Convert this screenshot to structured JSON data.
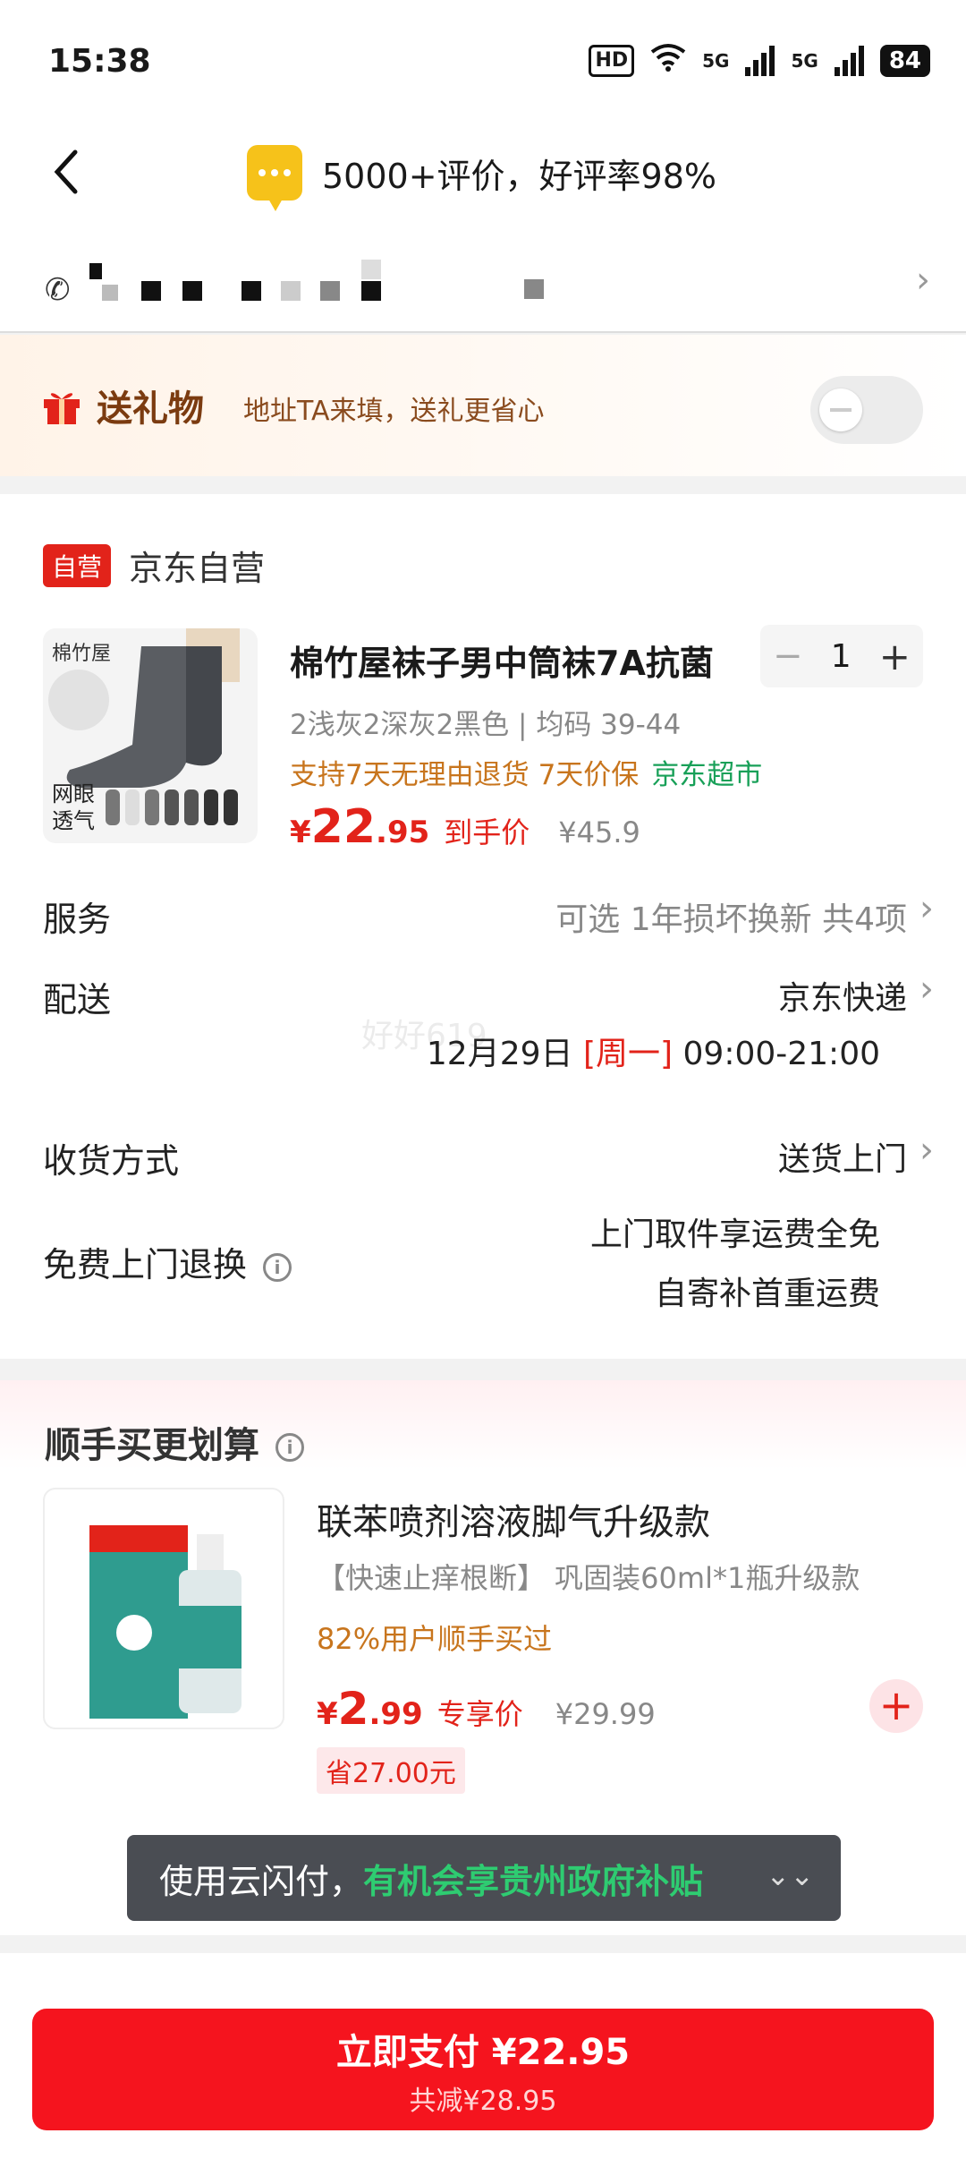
{
  "status": {
    "time": "15:38",
    "hd": "HD",
    "net1": "5G",
    "net2": "5G",
    "battery": "84"
  },
  "header": {
    "rating": "5000+评价，好评率98%"
  },
  "gift": {
    "title": "送礼物",
    "desc": "地址TA来填，送礼更省心"
  },
  "shop": {
    "tag": "自营",
    "name": "京东自营"
  },
  "product": {
    "image_brand": "棉竹屋",
    "image_label_line1": "网眼",
    "image_label_line2": "透气",
    "title": "棉竹屋袜子男中筒袜7A抗菌",
    "spec": "2浅灰2深灰2黑色 | 均码 39-44",
    "service": "支持7天无理由退货 7天价保",
    "service_green": "京东超市",
    "price_yen": "¥",
    "price_int": "22",
    "price_dec": ".95",
    "price_tag": "到手价",
    "orig_price": "¥45.9",
    "qty": "1",
    "minus": "−",
    "plus": "+"
  },
  "rows": {
    "service_label": "服务",
    "service_value": "可选 1年损坏换新 共4项",
    "delivery_label": "配送",
    "delivery_value": "京东快递",
    "delivery_date": "12月29日",
    "delivery_day": "[周一]",
    "delivery_hours": "09:00-21:00",
    "receive_label": "收货方式",
    "receive_value": "送货上门",
    "return_label": "免费上门退换",
    "return_line1": "上门取件享运费全免",
    "return_line2": "自寄补首重运费"
  },
  "upsell": {
    "title": "顺手买更划算",
    "name": "联苯喷剂溶液脚气升级款",
    "desc": "【快速止痒根断】 巩固装60ml*1瓶升级款",
    "bought": "82%用户顺手买过",
    "price_yen": "¥",
    "price_int": "2",
    "price_dec": ".99",
    "price_tag": "专享价",
    "orig_price": "¥29.99",
    "save": "省27.00元",
    "add": "+"
  },
  "yunshan": {
    "prefix": "使用云闪付，",
    "highlight": "有机会享贵州政府补贴"
  },
  "footer": {
    "pay": "立即支付 ¥22.95",
    "saved": "共减¥28.95"
  },
  "watermark": "好好619"
}
